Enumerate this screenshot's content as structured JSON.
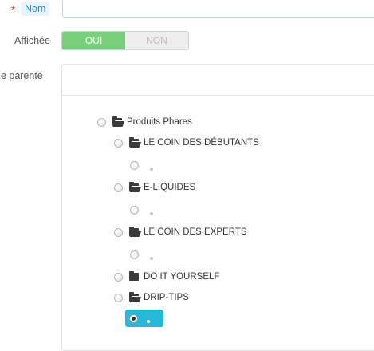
{
  "form": {
    "name_field": {
      "required_mark": "*",
      "label": "Nom",
      "value": ""
    },
    "displayed_field": {
      "label": "Affichée",
      "on_label": "OUI",
      "off_label": "NON",
      "value": "OUI"
    },
    "parent_category": {
      "label": "rie parente"
    }
  },
  "tree": {
    "root": {
      "label": "Produits Phares"
    },
    "children": [
      {
        "label": "LE COIN DES DÉBUTANTS",
        "expanded": true
      },
      {
        "label": "E-LIQUIDES",
        "expanded": true
      },
      {
        "label": "LE COIN DES EXPERTS",
        "expanded": true
      },
      {
        "label": "DO IT YOURSELF",
        "expanded": false
      },
      {
        "label": "DRIP-TIPS",
        "expanded": true
      }
    ],
    "selected_color": "#25b9d7"
  },
  "colors": {
    "switch_on": "#78d07d",
    "required": "#e0453d",
    "label_badge": "#e8f4fc"
  }
}
